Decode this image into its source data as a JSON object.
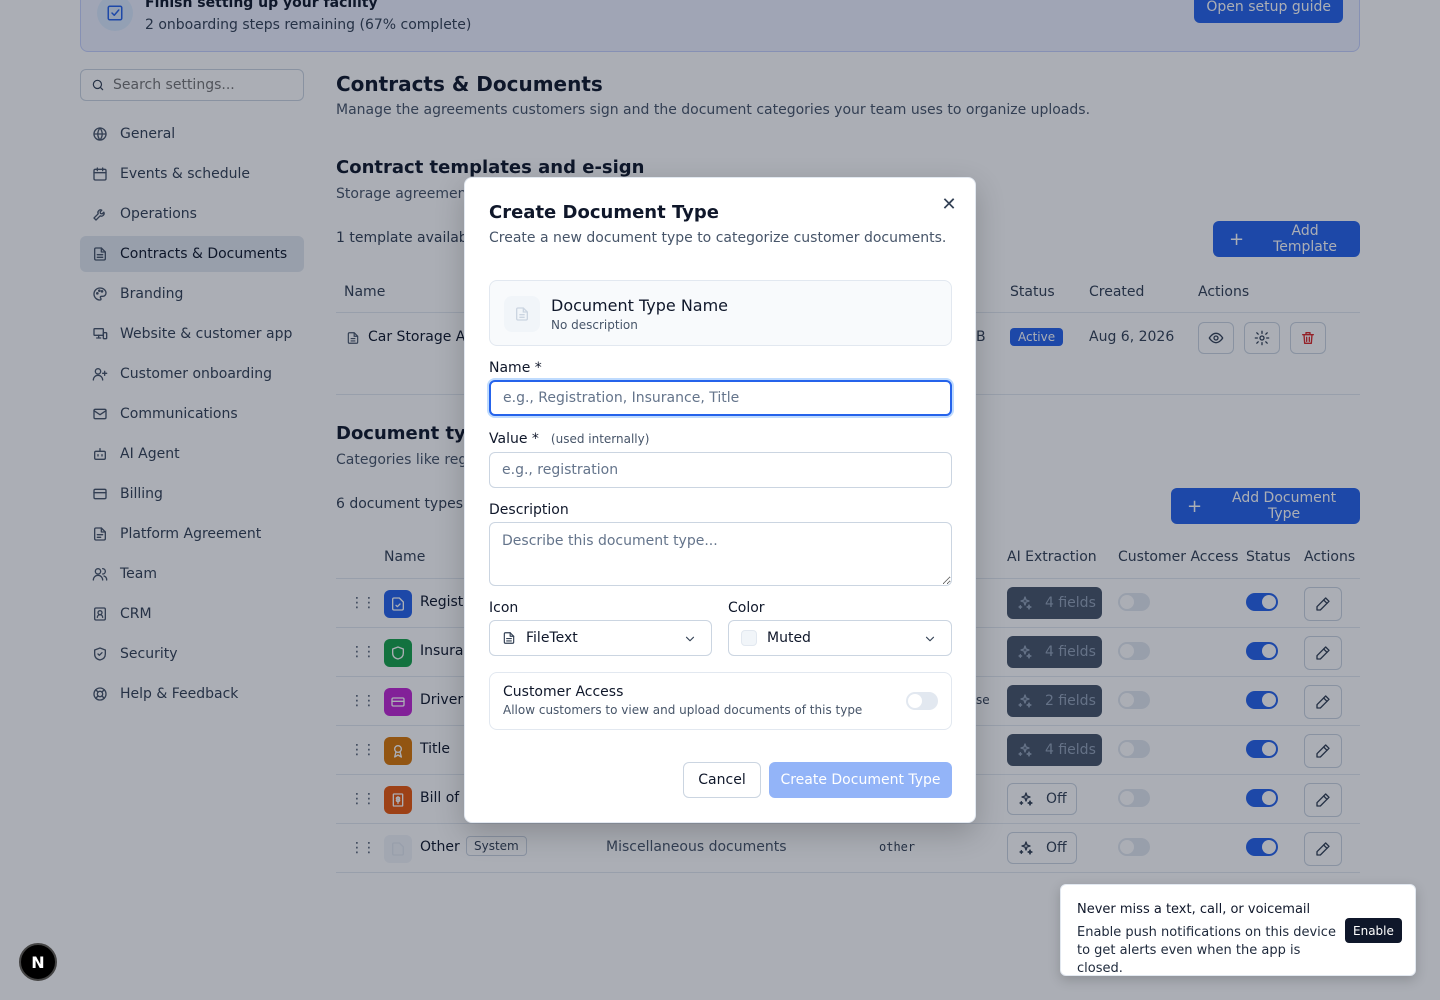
{
  "banner": {
    "title": "Finish setting up your facility",
    "subtitle": "2 onboarding steps remaining (67% complete)",
    "button": "Open setup guide"
  },
  "sidebar": {
    "search_placeholder": "Search settings...",
    "items": [
      {
        "label": "General",
        "icon": "globe-icon"
      },
      {
        "label": "Events & schedule",
        "icon": "calendar-icon"
      },
      {
        "label": "Operations",
        "icon": "wrench-icon"
      },
      {
        "label": "Contracts & Documents",
        "icon": "file-text-icon",
        "active": true
      },
      {
        "label": "Branding",
        "icon": "palette-icon"
      },
      {
        "label": "Website & customer app",
        "icon": "monitor-icon"
      },
      {
        "label": "Customer onboarding",
        "icon": "user-plus-icon"
      },
      {
        "label": "Communications",
        "icon": "mail-icon"
      },
      {
        "label": "AI Agent",
        "icon": "bot-icon"
      },
      {
        "label": "Billing",
        "icon": "credit-card-icon"
      },
      {
        "label": "Platform Agreement",
        "icon": "file-icon"
      },
      {
        "label": "Team",
        "icon": "users-icon"
      },
      {
        "label": "CRM",
        "icon": "contact-icon"
      },
      {
        "label": "Security",
        "icon": "shield-icon"
      },
      {
        "label": "Help & Feedback",
        "icon": "life-buoy-icon"
      }
    ]
  },
  "page": {
    "title": "Contracts & Documents",
    "description": "Manage the agreements customers sign and the document categories your team uses to organize uploads."
  },
  "templates": {
    "title": "Contract templates and e-sign",
    "description": "Storage agreement",
    "count": "1 template available",
    "add_button": "Add Template",
    "columns": {
      "name": "Name",
      "status": "Status",
      "created": "Created",
      "actions": "Actions"
    },
    "rows": [
      {
        "name": "Car Storage Ag",
        "size_tail": "B",
        "status": "Active",
        "created": "Aug 6, 2026"
      }
    ]
  },
  "doc_types": {
    "title": "Document typ",
    "description": "Categories like regi",
    "count": "6 document types",
    "add_button": "Add Document Type",
    "columns": {
      "name": "Name",
      "ai": "AI Extraction",
      "access": "Customer Access",
      "status": "Status",
      "actions": "Actions"
    },
    "rows": [
      {
        "name": "Registr",
        "color": "#2563eb",
        "icon": "file-check-icon",
        "ai": "4 fields",
        "ai_on": true,
        "access": false,
        "status": true
      },
      {
        "name": "Insurai",
        "color": "#16a34a",
        "icon": "shield-icon",
        "ai": "4 fields",
        "ai_on": true,
        "access": false,
        "status": true
      },
      {
        "name": "Driver'",
        "color": "#c026d3",
        "icon": "id-card-icon",
        "value_tail": "se",
        "ai": "2 fields",
        "ai_on": true,
        "access": false,
        "status": true
      },
      {
        "name": "Title",
        "color": "#d97706",
        "icon": "award-icon",
        "ai": "4 fields",
        "ai_on": true,
        "access": false,
        "status": true
      },
      {
        "name": "Bill of S",
        "color": "#ea580c",
        "icon": "receipt-icon",
        "ai": "Off",
        "ai_on": false,
        "access": false,
        "status": true
      },
      {
        "name": "Other",
        "color": "#f1f5f9",
        "icon": "file-icon",
        "badge": "System",
        "description": "Miscellaneous documents",
        "value": "other",
        "ai": "Off",
        "ai_on": false,
        "access": false,
        "status": true
      }
    ]
  },
  "modal": {
    "title": "Create Document Type",
    "description": "Create a new document type to categorize customer documents.",
    "preview_name": "Document Type Name",
    "preview_desc": "No description",
    "name_label": "Name *",
    "name_placeholder": "e.g., Registration, Insurance, Title",
    "value_label": "Value *",
    "value_hint": "(used internally)",
    "value_placeholder": "e.g., registration",
    "desc_label": "Description",
    "desc_placeholder": "Describe this document type...",
    "icon_label": "Icon",
    "icon_value": "FileText",
    "color_label": "Color",
    "color_value": "Muted",
    "access_title": "Customer Access",
    "access_desc": "Allow customers to view and upload documents of this type",
    "cancel": "Cancel",
    "create": "Create Document Type",
    "close_glyph": "✕"
  },
  "toast": {
    "title": "Never miss a text, call, or voicemail",
    "body": "Enable push notifications on this device to get alerts even when the app is closed.",
    "button": "Enable"
  },
  "logo_letter": "N"
}
